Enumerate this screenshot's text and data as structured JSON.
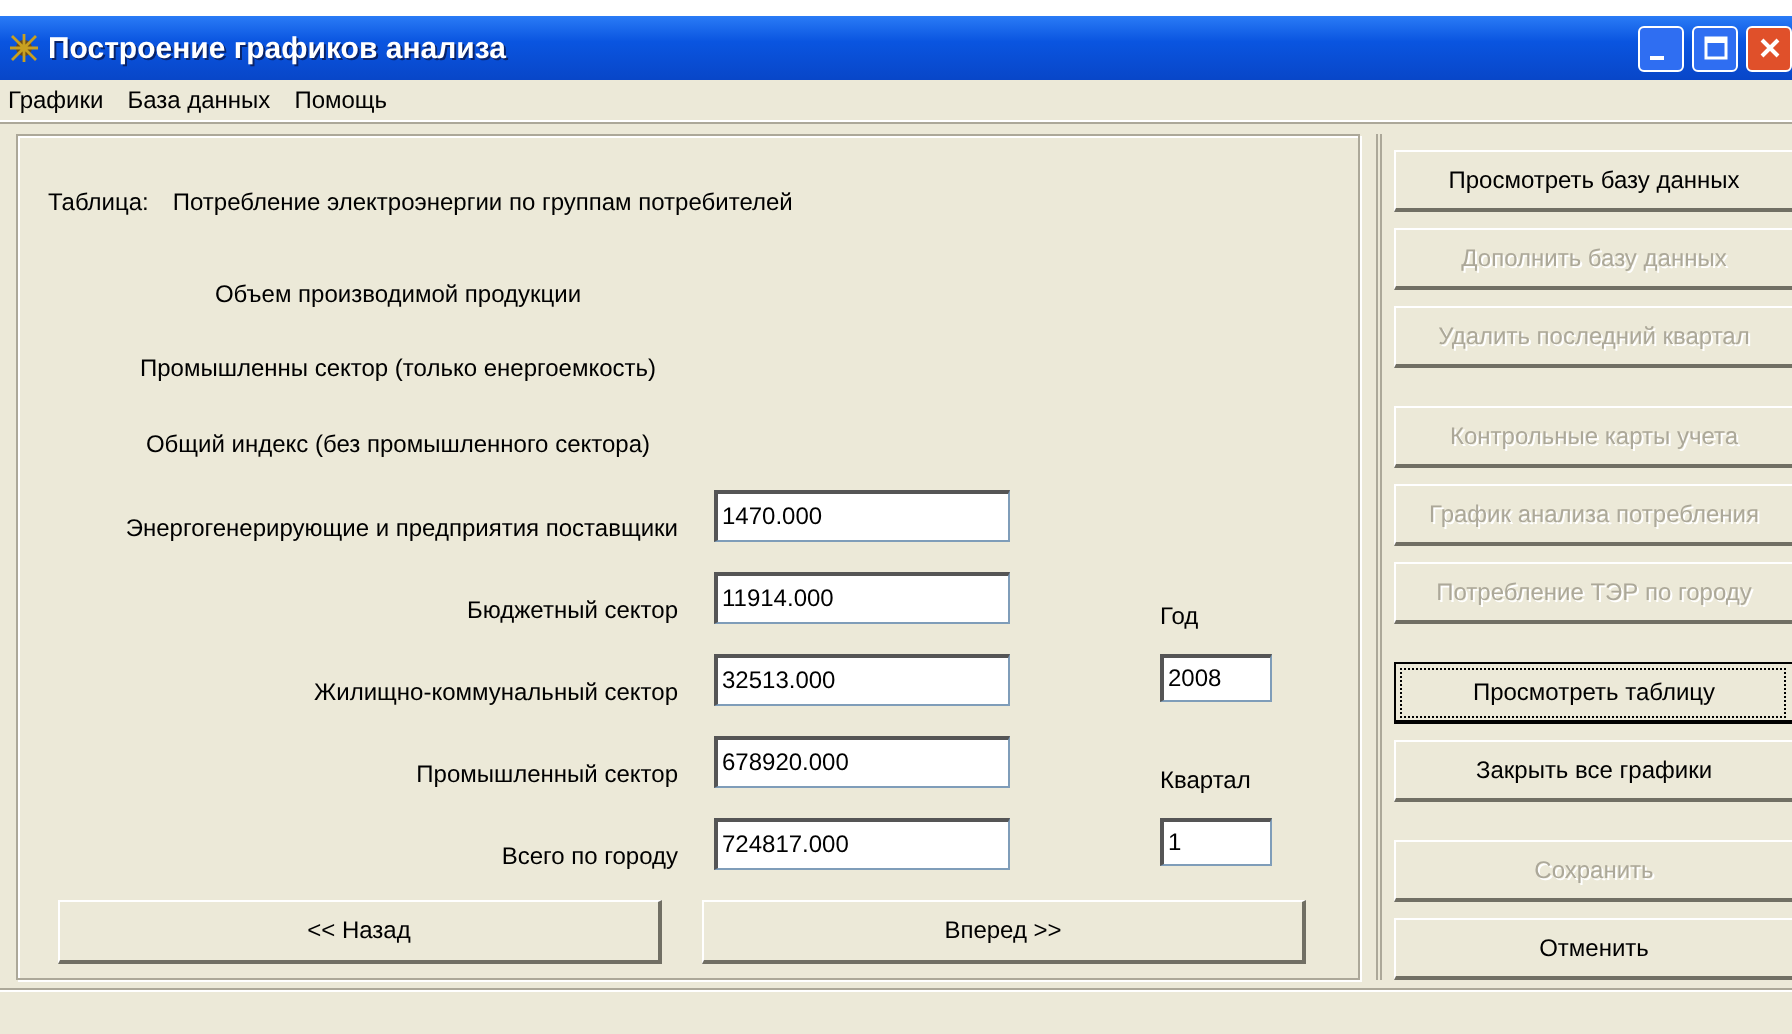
{
  "window": {
    "title": "Построение графиков анализа"
  },
  "menu": [
    "Графики",
    "База данных",
    "Помощь"
  ],
  "table": {
    "label": "Таблица:",
    "name": "Потребление электроэнергии по группам потребителей"
  },
  "headings": [
    "Объем производимой продукции",
    "Промышленны сектор (только енергоемкость)",
    "Общий индекс (без промышленного сектора)"
  ],
  "fields": [
    {
      "label": "Энергогенерирующие и предприятия поставщики",
      "value": "1470.000"
    },
    {
      "label": "Бюджетный сектор",
      "value": "11914.000"
    },
    {
      "label": "Жилищно-коммунальный сектор",
      "value": "32513.000"
    },
    {
      "label": "Промышленный сектор",
      "value": "678920.000"
    },
    {
      "label": "Всего по городу",
      "value": "724817.000"
    }
  ],
  "year": {
    "label": "Год",
    "value": "2008"
  },
  "quarter": {
    "label": "Квартал",
    "value": "1"
  },
  "nav_buttons": [
    "<< Назад",
    "Вперед >>"
  ],
  "side_groups": [
    [
      {
        "label": "Просмотреть базу данных",
        "disabled": false,
        "focused": false
      },
      {
        "label": "Дополнить базу данных",
        "disabled": true,
        "focused": false
      },
      {
        "label": "Удалить последний квартал",
        "disabled": true,
        "focused": false
      }
    ],
    [
      {
        "label": "Контрольные карты учета",
        "disabled": true,
        "focused": false
      },
      {
        "label": "График анализа потребления",
        "disabled": true,
        "focused": false
      },
      {
        "label": "Потребление ТЭР по городу",
        "disabled": true,
        "focused": false
      }
    ],
    [
      {
        "label": "Просмотреть таблицу",
        "disabled": false,
        "focused": true
      },
      {
        "label": "Закрыть все графики",
        "disabled": false,
        "focused": false
      }
    ],
    [
      {
        "label": "Сохранить",
        "disabled": true,
        "focused": false
      },
      {
        "label": "Отменить",
        "disabled": false,
        "focused": false
      }
    ]
  ]
}
